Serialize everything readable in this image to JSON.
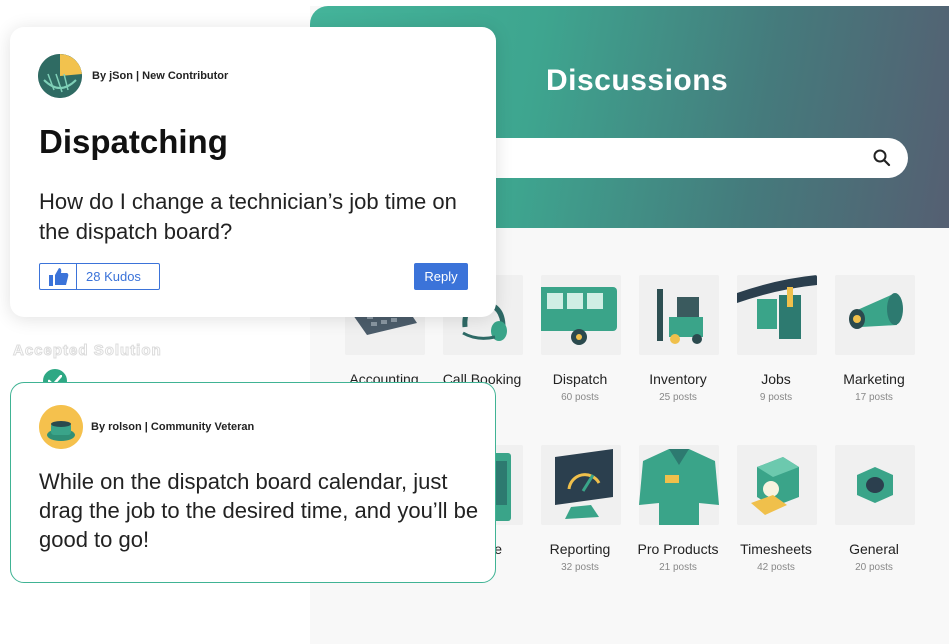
{
  "forum": {
    "title": "Discussions",
    "search": {
      "placeholder": ""
    },
    "categories": [
      {
        "name": "Accounting",
        "posts": "",
        "icon": "keypad-icon"
      },
      {
        "name": "Call Booking",
        "posts": "",
        "icon": "headset-icon"
      },
      {
        "name": "Dispatch",
        "posts": "60 posts",
        "icon": "bus-icon"
      },
      {
        "name": "Inventory",
        "posts": "25 posts",
        "icon": "forklift-icon"
      },
      {
        "name": "Jobs",
        "posts": "9 posts",
        "icon": "toolbelt-icon"
      },
      {
        "name": "Marketing",
        "posts": "17 posts",
        "icon": "megaphone-icon"
      },
      {
        "name": "e",
        "posts": "",
        "icon": "device-icon"
      },
      {
        "name": "Reporting",
        "posts": "32 posts",
        "icon": "gauge-monitor-icon"
      },
      {
        "name": "Pro Products",
        "posts": "21 posts",
        "icon": "uniform-shirt-icon"
      },
      {
        "name": "Timesheets",
        "posts": "42 posts",
        "icon": "time-clock-icon"
      },
      {
        "name": "General",
        "posts": "20 posts",
        "icon": "hex-nut-icon"
      }
    ]
  },
  "question": {
    "byline": "By jSon  | New Contributor",
    "title": "Dispatching",
    "body": "How do I change a technician’s job time on the dispatch board?",
    "kudos_label": "28 Kudos",
    "reply_label": "Reply"
  },
  "accepted_label": "Accepted Solution",
  "answer": {
    "byline": "By rolson  | Community Veteran",
    "body": "While on the dispatch board calendar, just drag the job to the desired time, and you’ll be good to go!"
  },
  "colors": {
    "accent": "#44b49a",
    "brand_blue": "#3b73d9",
    "check_green": "#2ea884"
  }
}
